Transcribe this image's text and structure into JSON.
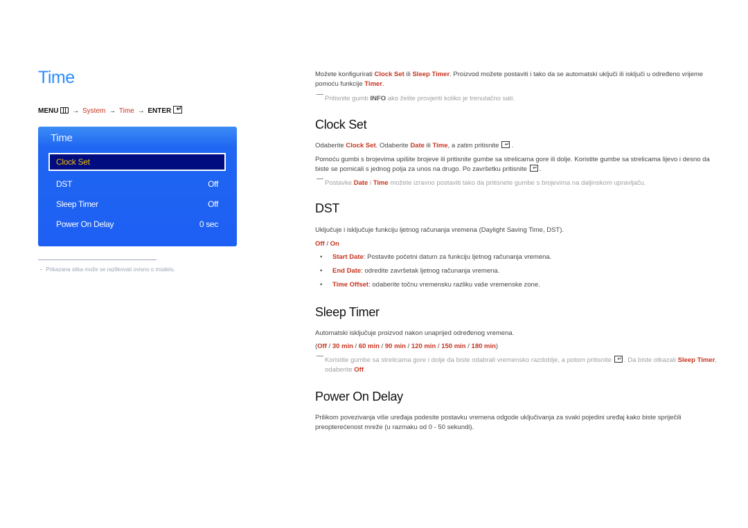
{
  "page": {
    "title": "Time",
    "menu_path": {
      "menu": "MENU",
      "arrow": "→",
      "system": "System",
      "time": "Time",
      "enter": "ENTER",
      "menu_icon": "menu-icon",
      "enter_icon": "enter-icon"
    }
  },
  "osd": {
    "title": "Time",
    "items": [
      {
        "label": "Clock Set",
        "value": "",
        "selected": true
      },
      {
        "label": "DST",
        "value": "Off"
      },
      {
        "label": "Sleep Timer",
        "value": "Off"
      },
      {
        "label": "Power On Delay",
        "value": "0 sec"
      }
    ],
    "colors": {
      "panel": "#1f66f2",
      "selected_bg": "#000c80",
      "selected_text": "#f0b800"
    }
  },
  "footnote": "Prikazana slika može se razlikovati ovisno o modelu.",
  "intro": {
    "t1": "Možete konfigurirati ",
    "r1": "Clock Set",
    "t2": " ili ",
    "r2": "Sleep Timer",
    "t3": ". Proizvod možete postaviti i tako da se automatski uključi ili isključi u određeno vrijeme pomoću funkcije ",
    "r3": "Timer",
    "t4": ".",
    "note_t1": "Pritisnite gumb ",
    "note_b1": "INFO",
    "note_t2": " ako želite provjeriti koliko je trenutačno sati."
  },
  "clock_set": {
    "heading": "Clock Set",
    "p1_t1": "Odaberite ",
    "p1_r1": "Clock Set",
    "p1_t2": ". Odaberite ",
    "p1_r2": "Date",
    "p1_t3": " ili ",
    "p1_r3": "Time",
    "p1_t4": ", a zatim pritisnite",
    "p1_t5": ".",
    "p2": "Pomoću gumbi s brojevima upišite brojeve ili pritisnite gumbe sa strelicama gore ili dolje. Koristite gumbe sa strelicama lijevo i desno da biste se pomicali s jednog polja za unos na drugo. Po završetku pritisnite",
    "p2_end": ".",
    "note_t1": "Postavke ",
    "note_r1": "Date",
    "note_t2": " i ",
    "note_r2": "Time",
    "note_t3": " možete izravno postaviti tako da pritisnete gumbe s brojevima na daljinskom upravljaču."
  },
  "dst": {
    "heading": "DST",
    "p1": "Uključuje i isključuje funkciju ljetnog računanja vremena (Daylight Saving Time, DST).",
    "opt_off": "Off",
    "opt_sep": " / ",
    "opt_on": "On",
    "bullets": [
      {
        "label": "Start Date",
        "text": ": Postavite početni datum za funkciju ljetnog računanja vremena."
      },
      {
        "label": "End Date",
        "text": ": odredite završetak ljetnog računanja vremena."
      },
      {
        "label": "Time Offset",
        "text": ": odaberite točnu vremensku razliku vaše vremenske zone."
      }
    ],
    "bullet_glyph": "•"
  },
  "sleep_timer": {
    "heading": "Sleep Timer",
    "p1": "Automatski isključuje proizvod nakon unaprijed određenog vremena.",
    "options": [
      "Off",
      "30 min",
      "60 min",
      "90 min",
      "120 min",
      "150 min",
      "180 min"
    ],
    "open": "(",
    "close": ")",
    "sep": " / ",
    "note_t1": "Koristite gumbe sa strelicama gore i dolje da biste odabrali vremensko razdoblje, a potom pritisnite",
    "note_t2": ". Da biste otkazali ",
    "note_r1": "Sleep Timer",
    "note_t3": ", odaberite ",
    "note_r2": "Off",
    "note_t4": "."
  },
  "power_on_delay": {
    "heading": "Power On Delay",
    "p1": "Prilikom povezivanja više uređaja podesite postavku vremena odgode uključivanja za svaki pojedini uređaj kako biste spriječili preopterećenost mreže (u razmaku od 0 - 50 sekundi)."
  }
}
